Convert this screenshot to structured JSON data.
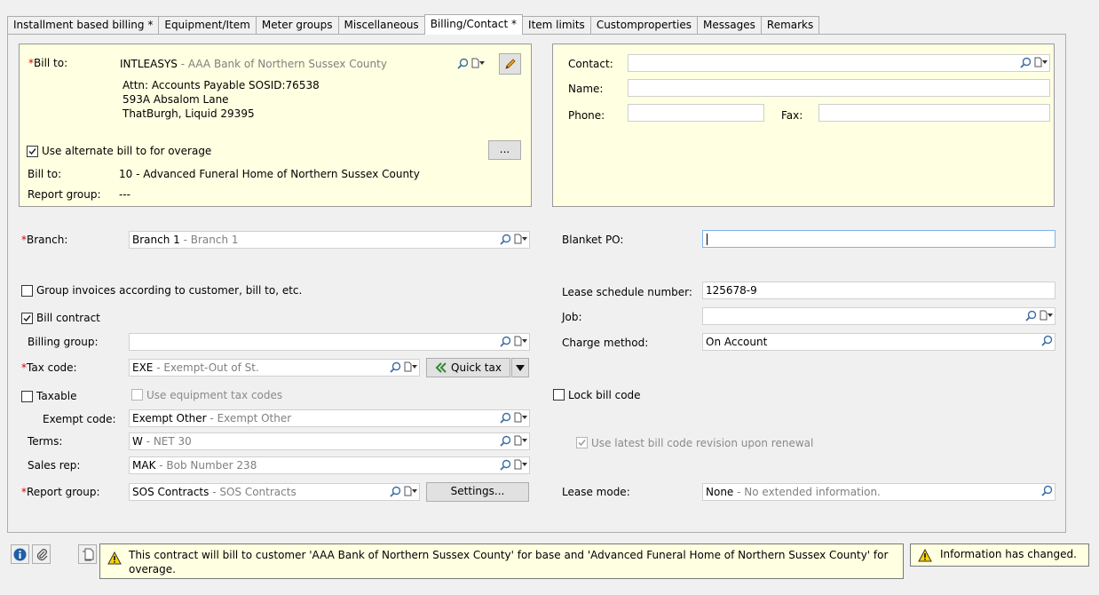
{
  "tabs": [
    {
      "label": "Installment based billing *",
      "active": false
    },
    {
      "label": "Equipment/Item",
      "active": false
    },
    {
      "label": "Meter groups",
      "active": false
    },
    {
      "label": "Miscellaneous",
      "active": false
    },
    {
      "label": "Billing/Contact *",
      "active": true
    },
    {
      "label": "Item limits",
      "active": false
    },
    {
      "label": "Customproperties",
      "active": false
    },
    {
      "label": "Messages",
      "active": false
    },
    {
      "label": "Remarks",
      "active": false
    }
  ],
  "bill_to": {
    "label": "Bill to:",
    "required_mark": "*",
    "code": "INTLEASYS",
    "desc": " - AAA Bank of Northern Sussex County",
    "addr1": "Attn: Accounts Payable SOSID:76538",
    "addr2": "593A Absalom Lane",
    "addr3": "ThatBurgh, Liquid 29395",
    "alt_label": "Use alternate bill to for overage",
    "alt_checked": true,
    "alt_button": "...",
    "alt_bill_label": "Bill to:",
    "alt_bill_value": "10 - Advanced Funeral Home of Northern Sussex County",
    "report_group_label": "Report group:",
    "report_group_value": "---"
  },
  "contact": {
    "contact_label": "Contact:",
    "contact_value": "",
    "name_label": "Name:",
    "name_value": "",
    "phone_label": "Phone:",
    "phone_value": "",
    "fax_label": "Fax:",
    "fax_value": ""
  },
  "left": {
    "branch_label": "Branch:",
    "branch_code": "Branch 1",
    "branch_desc": " - Branch 1",
    "group_invoices_label": "Group invoices according to customer, bill to, etc.",
    "group_invoices_checked": false,
    "bill_contract_label": "Bill contract",
    "bill_contract_checked": true,
    "billing_group_label": "Billing group:",
    "billing_group_value": "",
    "tax_code_label": "Tax code:",
    "tax_code_code": "EXE",
    "tax_code_desc": " - Exempt-Out of St.",
    "quick_tax_label": "Quick tax",
    "taxable_label": "Taxable",
    "taxable_checked": false,
    "use_equip_tax_label": "Use equipment tax codes",
    "use_equip_tax_checked": false,
    "exempt_code_label": "Exempt code:",
    "exempt_code_code": "Exempt Other",
    "exempt_code_desc": " - Exempt Other",
    "terms_label": "Terms:",
    "terms_code": "W",
    "terms_desc": " - NET 30",
    "sales_rep_label": "Sales rep:",
    "sales_rep_code": "MAK",
    "sales_rep_desc": " - Bob Number 238",
    "report_group_label": "Report group:",
    "report_group_code": "SOS Contracts",
    "report_group_desc": " - SOS Contracts",
    "settings_label": "Settings..."
  },
  "right": {
    "blanket_po_label": "Blanket PO:",
    "blanket_po_value": "",
    "lease_schedule_label": "Lease schedule number:",
    "lease_schedule_value": "125678-9",
    "job_label": "Job:",
    "job_value": "",
    "charge_method_label": "Charge method:",
    "charge_method_value": "On Account",
    "lock_bill_code_label": "Lock bill code",
    "lock_bill_code_checked": false,
    "latest_revision_label": "Use latest bill code revision upon renewal",
    "latest_revision_checked": true,
    "lease_mode_label": "Lease mode:",
    "lease_mode_code": "None",
    "lease_mode_desc": " - No extended information."
  },
  "status": {
    "message": "This contract will bill to customer 'AAA Bank of Northern Sussex County' for base and 'Advanced Funeral Home of Northern Sussex County' for overage.",
    "changed": "Information has changed."
  }
}
